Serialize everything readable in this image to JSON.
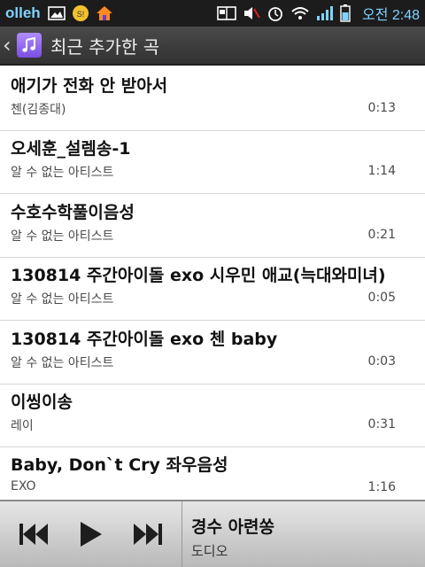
{
  "status_bar": {
    "carrier": "olleh",
    "time": "오전 2:48"
  },
  "action_bar": {
    "title": "최근 추가한 곡"
  },
  "songs": [
    {
      "title": "애기가 전화 안 받아서",
      "artist": "첸(김종대)",
      "duration": "0:13"
    },
    {
      "title": "오세훈_설렘송-1",
      "artist": "알 수 없는 아티스트",
      "duration": "1:14"
    },
    {
      "title": "수호수학풀이음성",
      "artist": "알 수 없는 아티스트",
      "duration": "0:21"
    },
    {
      "title": "130814 주간아이돌 exo 시우민 애교(늑대와미녀)",
      "artist": "알 수 없는 아티스트",
      "duration": "0:05"
    },
    {
      "title": "130814 주간아이돌 exo 첸 baby",
      "artist": "알 수 없는 아티스트",
      "duration": "0:03"
    },
    {
      "title": "이씽이송",
      "artist": "레이",
      "duration": "0:31"
    },
    {
      "title": "Baby, Don`t Cry 좌우음성",
      "artist": "EXO",
      "duration": "1:16"
    }
  ],
  "now_playing": {
    "title": "경수 아련쏭",
    "artist": "도디오"
  },
  "icons": {
    "back": "chevron-left-icon",
    "app": "music-note-icon",
    "prev": "skip-previous-icon",
    "play": "play-icon",
    "next": "skip-next-icon"
  },
  "colors": {
    "status_accent": "#7fd3ff",
    "action_bar": "#3d3d3d",
    "app_icon": "#9a6cf0",
    "player_bg": "#d0d0d0"
  }
}
